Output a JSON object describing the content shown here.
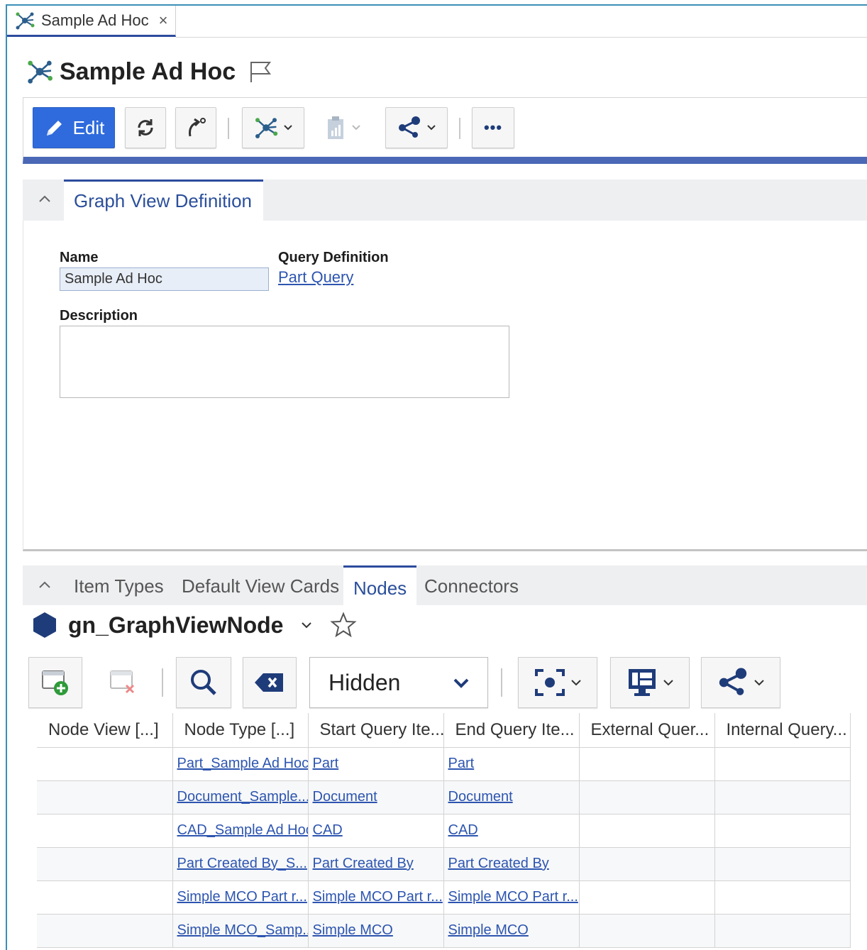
{
  "tab": {
    "label": "Sample Ad Hoc",
    "close": "×"
  },
  "title": "Sample Ad Hoc",
  "toolbar": {
    "edit_label": "Edit",
    "more": "•••"
  },
  "section": {
    "tab_label": "Graph View Definition"
  },
  "form": {
    "name_label": "Name",
    "name_value": "Sample Ad Hoc",
    "query_label": "Query Definition",
    "query_link": "Part Query",
    "description_label": "Description",
    "description_value": ""
  },
  "lower_tabs": [
    "Item Types",
    "Default View Cards",
    "Nodes",
    "Connectors"
  ],
  "itemtype": {
    "name": "gn_GraphViewNode"
  },
  "grid_toolbar": {
    "filter_value": "Hidden"
  },
  "grid": {
    "columns": [
      "Node View [...]",
      "Node Type [...]",
      "Start Query Ite...",
      "End Query Ite...",
      "External Quer...",
      "Internal Query..."
    ],
    "rows": [
      [
        "",
        "Part_Sample Ad Hoc",
        "Part",
        "Part",
        "",
        ""
      ],
      [
        "",
        "Document_Sample...",
        "Document",
        "Document",
        "",
        ""
      ],
      [
        "",
        "CAD_Sample Ad Hoc",
        "CAD",
        "CAD",
        "",
        ""
      ],
      [
        "",
        "Part Created By_S...",
        "Part Created By",
        "Part Created By",
        "",
        ""
      ],
      [
        "",
        "Simple MCO Part r...",
        "Simple MCO Part r...",
        "Simple MCO Part r...",
        "",
        ""
      ],
      [
        "",
        "Simple MCO_Samp...",
        "Simple MCO",
        "Simple MCO",
        "",
        ""
      ]
    ]
  },
  "colors": {
    "accent": "#2d4c9e",
    "primary_button": "#2f6bdc",
    "link": "#2d55b0"
  }
}
